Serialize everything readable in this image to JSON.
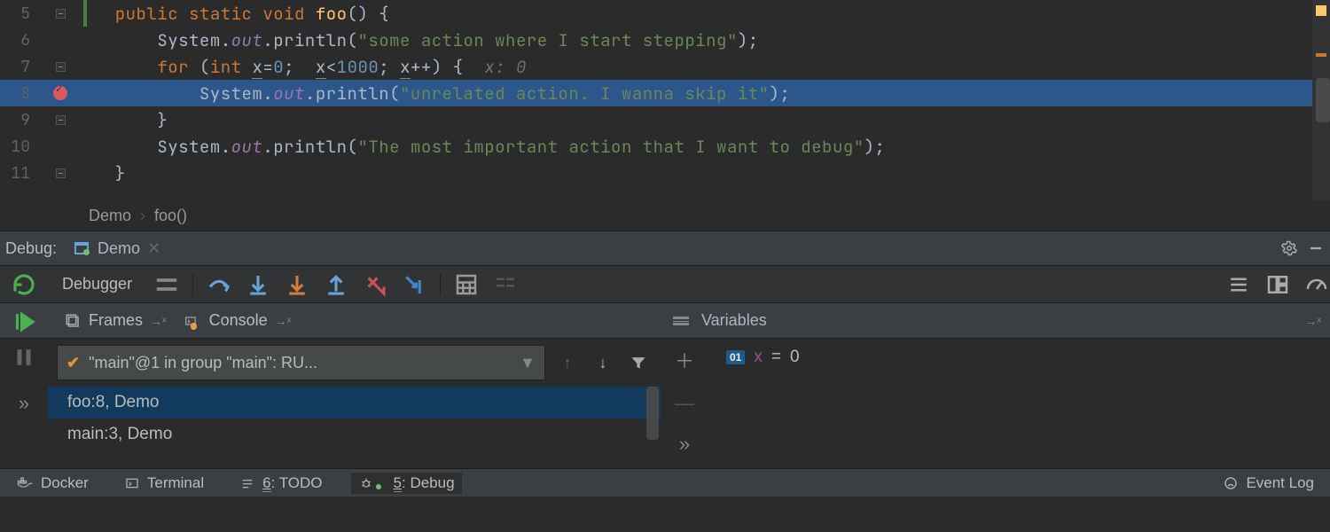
{
  "lines": {
    "l5n": "5",
    "l6n": "6",
    "l7n": "7",
    "l8n": "8",
    "l9n": "9",
    "l10n": "10",
    "l11n": "11",
    "l5": {
      "kw1": "public",
      "kw2": "static",
      "kw3": "void",
      "mth": "foo",
      "suffix": "() {"
    },
    "l6": {
      "pre": "System.",
      "field": "out",
      "mid": ".println(",
      "str": "\"some action where I start stepping\"",
      "end": ");"
    },
    "l7": {
      "kw1": "for",
      "p1": " (",
      "kw2": "int ",
      "v1": "x",
      "op1": "=",
      "n1": "0",
      "s1": ";  ",
      "v2": "x",
      "op2": "<",
      "n2": "1000",
      "s2": "; ",
      "v3": "x",
      "op3": "++",
      "p2": ") {  ",
      "hint": "x: 0"
    },
    "l8": {
      "pre": "System.",
      "field": "out",
      "mid": ".println(",
      "str": "\"unrelated action. I wanna skip it\"",
      "end": ");"
    },
    "l9": "}",
    "l10": {
      "pre": "System.",
      "field": "out",
      "mid": ".println(",
      "str": "\"The most important action that I want to debug\"",
      "end": ");"
    },
    "l11": "}"
  },
  "crumbs": {
    "a": "Demo",
    "b": "foo()"
  },
  "debug": {
    "label": "Debug:",
    "tab": "Demo"
  },
  "step": {
    "debugger": "Debugger"
  },
  "panels": {
    "frames": "Frames",
    "console": "Console",
    "vars": "Variables"
  },
  "thread": {
    "text": "\"main\"@1 in group \"main\": RU..."
  },
  "frames": [
    {
      "t": "foo:8, Demo"
    },
    {
      "t": "main:3, Demo"
    }
  ],
  "vars": [
    {
      "name": "x",
      "eq": " = ",
      "val": "0",
      "badge": "01"
    }
  ],
  "bottom": {
    "docker": "Docker",
    "terminal": "Terminal",
    "todo_pre": "6",
    "todo": ": TODO",
    "dbg_pre": "5",
    "dbg": ": Debug",
    "event": "Event Log"
  }
}
